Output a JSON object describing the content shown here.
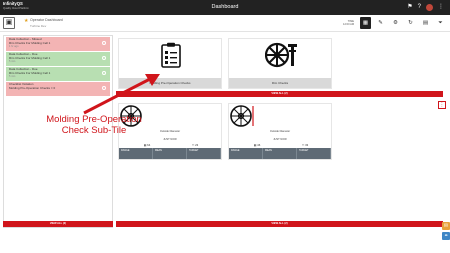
{
  "app": {
    "logo": "InfinityQS",
    "logo_sub": "Quality Cloud Platform",
    "title": "Dashboard"
  },
  "breadcrumb": {
    "title": "Operator Dashboard",
    "subtitle": "Turbine Dev"
  },
  "toolbar": {
    "time_line1": "TIME",
    "time_line2": "12:00 AM"
  },
  "alerts": [
    {
      "line1": "Data Collection - Missed",
      "line2": "Rim Checks For Molding Cell 1",
      "time": "1 hr ago",
      "color": "red"
    },
    {
      "line1": "Data Collection - Due",
      "line2": "Rim Checks For Molding Cell 1",
      "time": "5 min",
      "color": "green"
    },
    {
      "line1": "Data Collection - Due",
      "line2": "Rim Checks For Molding Cell 1",
      "time": "5 min",
      "color": "green"
    },
    {
      "line1": "Checklist Violation",
      "line2": "Molding Pre-Operation Checks = 0",
      "time": "",
      "color": "red"
    }
  ],
  "left_view_all": "VIEW ALL (2)",
  "tiles": [
    {
      "label": "Molding Pre-Operation Checks"
    },
    {
      "label": "Rim Checks"
    }
  ],
  "tiles_view_all": "VIEW ALL (2)",
  "minis": [
    {
      "label": "Outside Diameter",
      "status": "JUST NOW",
      "stat1": "64",
      "stat2": "23",
      "box": [
        "RANGE",
        "MEAN",
        "TARGET"
      ]
    },
    {
      "label": "Outside Diameter",
      "status": "JUST NOW",
      "stat1": "46",
      "stat2": "33",
      "box": [
        "RANGE",
        "MEAN",
        "TARGET"
      ]
    }
  ],
  "minis_view_all": "VIEW ALL (2)",
  "annotation": {
    "text": "Molding Pre-Operation Check Sub-Tile",
    "color": "#d0151b"
  },
  "colors": {
    "accent": "#d0151b",
    "topbar": "#222222"
  }
}
